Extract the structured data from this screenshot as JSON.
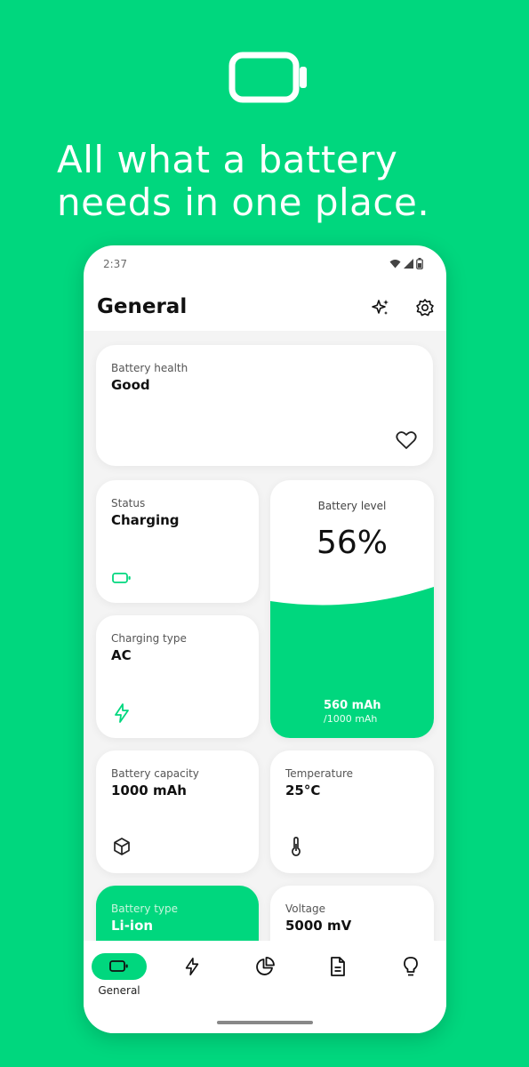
{
  "promo": {
    "icon": "battery-icon",
    "headline_line1": "All what a battery",
    "headline_line2": "needs in one place."
  },
  "status_bar": {
    "time": "2:37",
    "icons": [
      "wifi-icon",
      "signal-icon",
      "battery-status-icon"
    ]
  },
  "app_bar": {
    "title": "General",
    "actions": [
      "sparkles-icon",
      "settings-icon"
    ]
  },
  "cards": {
    "battery_health": {
      "label": "Battery health",
      "value": "Good",
      "icon": "heart-icon"
    },
    "status": {
      "label": "Status",
      "value": "Charging",
      "icon": "battery-icon"
    },
    "charging_type": {
      "label": "Charging type",
      "value": "AC",
      "icon": "bolt-icon"
    },
    "battery_level": {
      "label": "Battery level",
      "value": "56%",
      "level_percent": 56,
      "current": "560 mAh",
      "total": "/1000 mAh"
    },
    "battery_capacity": {
      "label": "Battery capacity",
      "value": "1000 mAh",
      "icon": "cube-icon"
    },
    "temperature": {
      "label": "Temperature",
      "value": "25°C",
      "icon": "thermometer-icon"
    },
    "battery_type": {
      "label": "Battery type",
      "value": "Li-ion"
    },
    "voltage": {
      "label": "Voltage",
      "value": "5000 mV"
    }
  },
  "bottom_nav": {
    "items": [
      {
        "label": "General",
        "icon": "battery-icon",
        "active": true
      },
      {
        "label": "",
        "icon": "bolt-icon",
        "active": false
      },
      {
        "label": "",
        "icon": "pie-chart-icon",
        "active": false
      },
      {
        "label": "",
        "icon": "document-icon",
        "active": false
      },
      {
        "label": "",
        "icon": "lightbulb-icon",
        "active": false
      }
    ]
  },
  "colors": {
    "accent": "#00d77e",
    "card_background": "#ffffff",
    "content_background": "#f4f4f4"
  }
}
